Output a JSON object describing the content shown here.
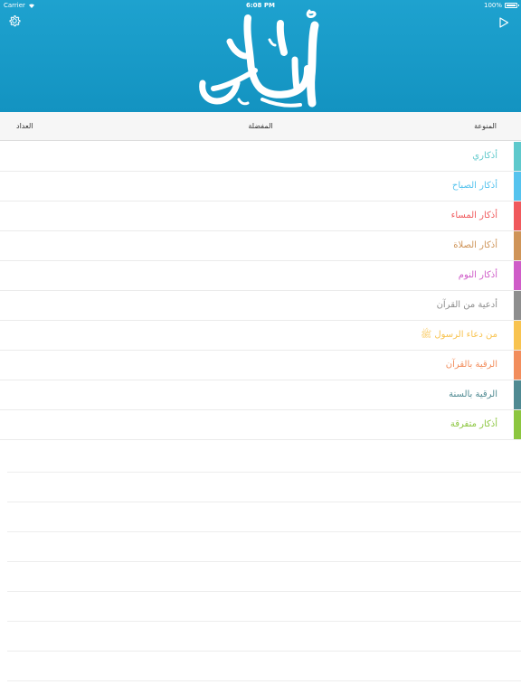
{
  "status_bar": {
    "carrier": "Carrier",
    "time": "6:08 PM",
    "battery": "100%"
  },
  "header": {
    "logo_icon": "adhkar-calligraphy-logo",
    "settings_icon": "gear-icon",
    "play_icon": "play-icon",
    "background_color": "#1a9ccb"
  },
  "tabs": {
    "counter": "العداد",
    "favorites": "المفضلة",
    "miscellaneous": "المنوعة"
  },
  "categories": [
    {
      "label": "أذكاري",
      "color": "#5ec9cc"
    },
    {
      "label": "أذكار الصباح",
      "color": "#55c3ee"
    },
    {
      "label": "أذكار المساء",
      "color": "#f0595c"
    },
    {
      "label": "أذكار الصلاة",
      "color": "#cf9458"
    },
    {
      "label": "أذكار النوم",
      "color": "#cf5cc8"
    },
    {
      "label": "أدعية من القرآن",
      "color": "#8e8e8e"
    },
    {
      "label": "من دعاء الرسول ﷺ",
      "color": "#f8c34f"
    },
    {
      "label": "الرقية بالقرآن",
      "color": "#f28d5c"
    },
    {
      "label": "الرقية بالسنة",
      "color": "#4f8a92"
    },
    {
      "label": "أذكار متفرقة",
      "color": "#8cc63f"
    }
  ]
}
